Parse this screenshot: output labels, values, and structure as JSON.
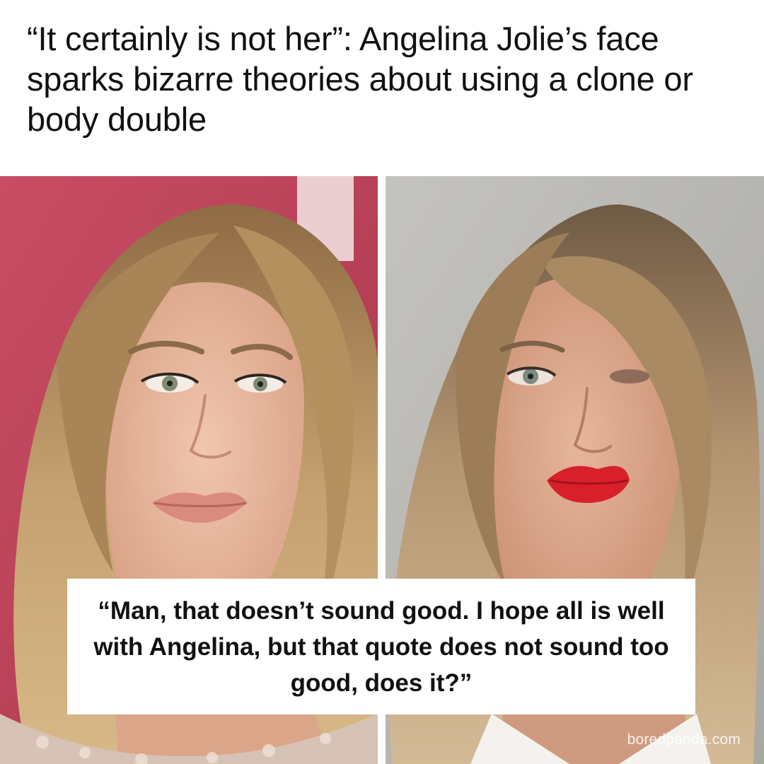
{
  "headline": "“It certainly is not her”: Angelina Jolie’s face sparks bizarre theories about using a clone or body double",
  "quote": "“Man, that doesn’t sound good. I hope all is well with Angelina, but that quote does not sound too good, does it?”",
  "watermark": "boredpanda.com",
  "colors": {
    "left_background": "#c8485f",
    "right_background": "#b9b8b3",
    "hair": "#b89466",
    "skin": "#e9b9a0",
    "lips_left": "#d98b7d",
    "lips_right": "#d8202a"
  }
}
